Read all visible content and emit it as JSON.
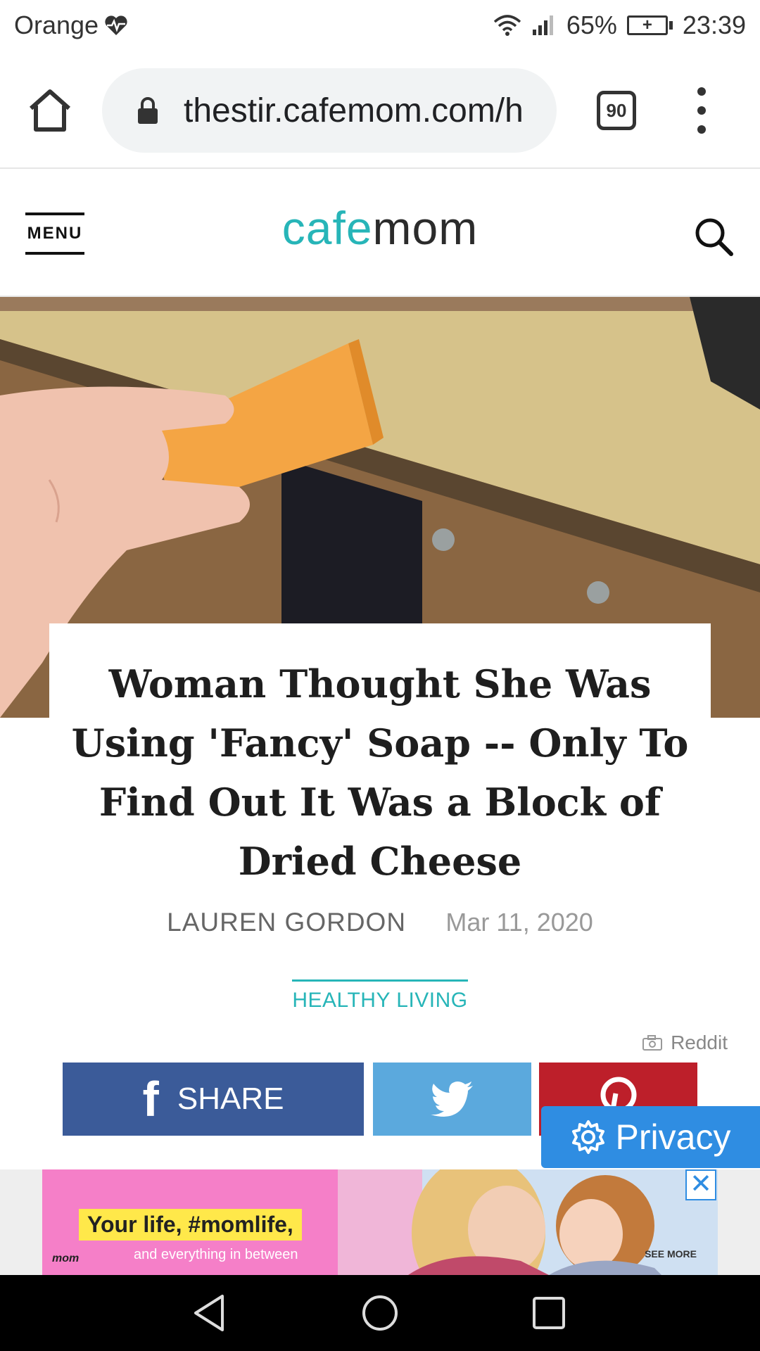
{
  "status": {
    "carrier": "Orange",
    "battery_percent": "65%",
    "time": "23:39"
  },
  "browser": {
    "url": "thestir.cafemom.com/h",
    "tab_count": "90"
  },
  "site": {
    "menu_label": "MENU",
    "logo_part1": "cafe",
    "logo_part2": "mom"
  },
  "article": {
    "title": "Woman Thought She Was Using 'Fancy' Soap -- Only To Find Out It Was a Block of Dried Cheese",
    "author": "LAUREN GORDON",
    "date": "Mar 11, 2020",
    "category": "HEALTHY LIVING",
    "image_credit": "Reddit"
  },
  "share": {
    "facebook_label": "SHARE"
  },
  "privacy": {
    "label": "Privacy"
  },
  "ad": {
    "headline": "Your life, #momlife,",
    "subline": "and everything in between",
    "see_more": "SEE MORE",
    "close_label": "✕"
  },
  "colors": {
    "brand_teal": "#27b5b8",
    "facebook": "#3b5b99",
    "twitter": "#5ba9dd",
    "pinterest": "#bd1f2a",
    "privacy_blue": "#2f8de2"
  }
}
